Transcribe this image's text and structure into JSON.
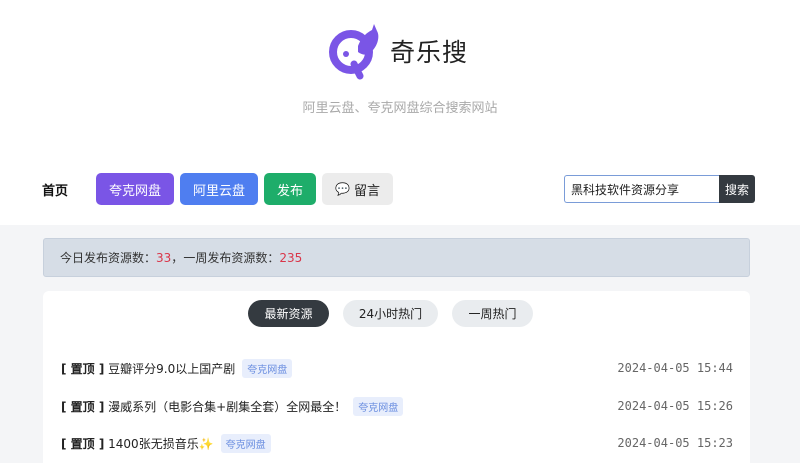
{
  "header": {
    "site_title": "奇乐搜",
    "subtitle": "阿里云盘、夸克网盘综合搜索网站",
    "logo_icon": "cat-magnifier-logo",
    "brand_color": "#7a55e6"
  },
  "nav": {
    "home": "首页",
    "quark": "夸克网盘",
    "aliyun": "阿里云盘",
    "publish": "发布",
    "message": "留言",
    "message_icon": "speech-bubble-icon"
  },
  "search": {
    "value": "黑科技软件资源分享",
    "button": "搜索"
  },
  "stats": {
    "today_label": "今日发布资源数：",
    "today_count": "33",
    "sep": "，",
    "week_label": "一周发布资源数：",
    "week_count": "235"
  },
  "tabs": {
    "latest": "最新资源",
    "hot24": "24小时热门",
    "week_hot": "一周热门"
  },
  "items": [
    {
      "pin": "[ 置顶 ]",
      "title": "豆瓣评分9.0以上国产剧",
      "tag": "夸克网盘",
      "time": "2024-04-05 15:44"
    },
    {
      "pin": "[ 置顶 ]",
      "title": "漫威系列（电影合集+剧集全套）全网最全！",
      "tag": "夸克网盘",
      "time": "2024-04-05 15:26"
    },
    {
      "pin": "[ 置顶 ]",
      "title": "1400张无损音乐✨",
      "tag": "夸克网盘",
      "time": "2024-04-05 15:23"
    }
  ]
}
